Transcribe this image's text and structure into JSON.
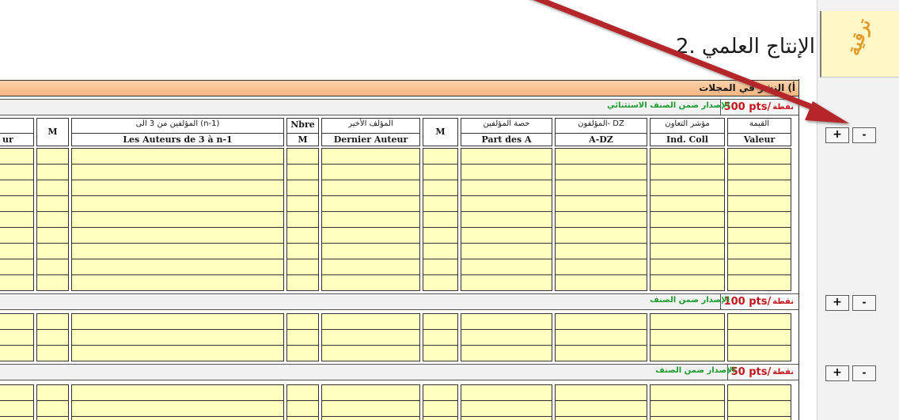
{
  "page": {
    "heading": "2. الإنتاج العلمي",
    "logo_text": "ترقية"
  },
  "section_a": {
    "title": "أ) النشر في المجلات"
  },
  "columns": [
    {
      "ar": "القيمة",
      "fr": "Valeur"
    },
    {
      "ar": "مؤشر التعاون",
      "fr": "Ind. Coll"
    },
    {
      "ar": "المؤلفون- DZ",
      "fr": "A-DZ"
    },
    {
      "ar": "حصة المؤلفين",
      "fr": "Part des A"
    },
    {
      "ar": "",
      "fr": "M"
    },
    {
      "ar": "المؤلف الأخير",
      "fr": "Dernier Auteur"
    },
    {
      "ar": "Nbre",
      "fr": "M"
    },
    {
      "ar": "المؤلفين من 3 الى (n-1)",
      "fr": "Les Auteurs de 3 à n-1"
    },
    {
      "ar": "",
      "fr": "M"
    },
    {
      "ar": "",
      "fr": "ur"
    }
  ],
  "categories": [
    {
      "pts": "500 pts/",
      "pts_label": "نقطة",
      "label": "الإصدار ضمن الصنف الاستثنائي"
    },
    {
      "pts": "100 pts/",
      "pts_label": "نقطة",
      "label": "الإصدار ضمن الصنف"
    },
    {
      "pts": "50 pts/",
      "pts_label": "نقطة",
      "label": "الإصدار ضمن الصنف"
    }
  ],
  "buttons": {
    "plus": "+",
    "minus": "-"
  },
  "colors": {
    "section_bar": "#f6b584",
    "cell_fill": "#ffffc0",
    "points_red": "#c0161e",
    "category_green": "#1b9b2f",
    "annotation_arrow": "#b5272c"
  },
  "annotation": {
    "type": "arrow",
    "points_to": "add-row-button"
  }
}
